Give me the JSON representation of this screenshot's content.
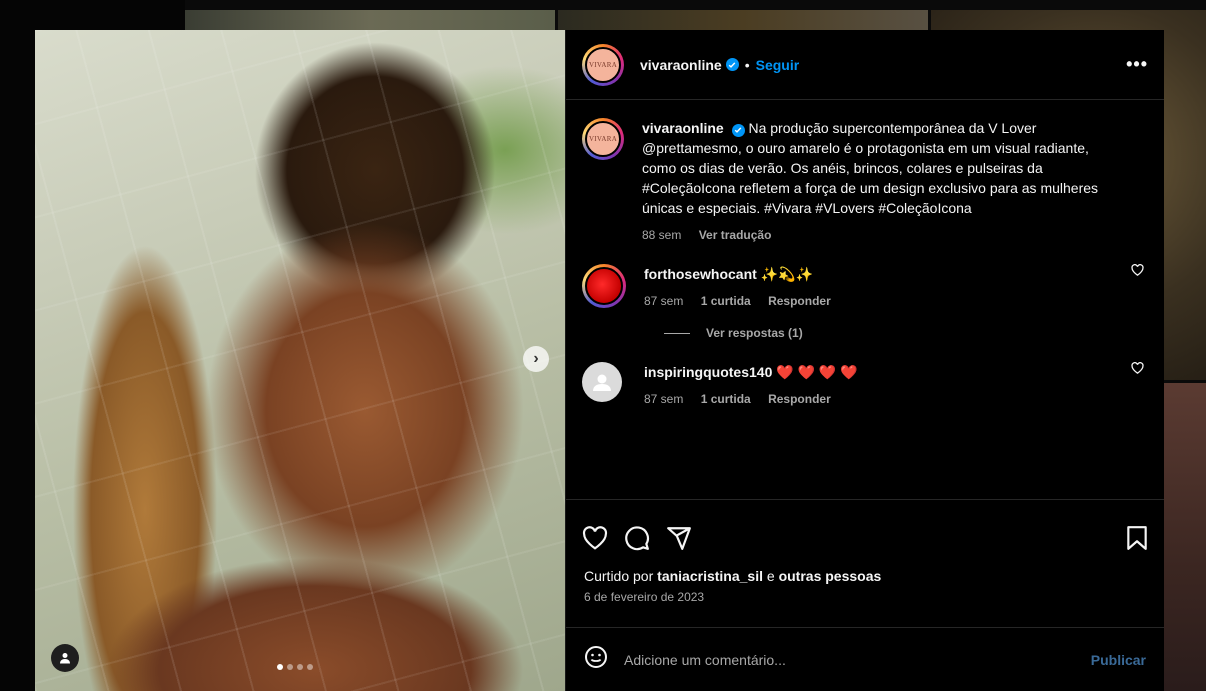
{
  "post": {
    "username": "vivaraonline",
    "avatar_text": "VIVARA",
    "follow_label": "Seguir",
    "separator": "•",
    "more_label": "•••",
    "carousel_next": "›",
    "carousel_dots": 4,
    "caption": {
      "username": "vivaraonline",
      "text": "Na produção supercontemporânea da V Lover @prettamesmo, o ouro amarelo é o protagonista em um visual radiante, como os dias de verão. Os anéis, brincos, colares e pulseiras da #ColeçãoIcona refletem a força de um design exclusivo para as mulheres únicas e especiais. #Vivara #VLovers #ColeçãoIcona",
      "time": "88 sem",
      "translate": "Ver tradução"
    },
    "comments": [
      {
        "username": "forthosewhocant",
        "text": "✨💫✨",
        "time": "87 sem",
        "likes": "1 curtida",
        "reply": "Responder",
        "view_replies": "Ver respostas (1)"
      },
      {
        "username": "inspiringquotes140",
        "text": "❤️ ❤️ ❤️ ❤️",
        "time": "87 sem",
        "likes": "1 curtida",
        "reply": "Responder"
      }
    ],
    "liked_by_prefix": "Curtido por",
    "liked_by_user": "taniacristina_sil",
    "liked_by_joiner": "e",
    "liked_by_suffix": "outras pessoas",
    "date": "6 de fevereiro de 2023",
    "add_comment_placeholder": "Adicione um comentário...",
    "publish_label": "Publicar"
  },
  "icons": [
    "like-icon",
    "comment-icon",
    "share-icon",
    "save-icon",
    "emoji-icon",
    "verified-icon",
    "user-tag-icon",
    "chevron-right-icon",
    "heart-small-icon"
  ],
  "colors": {
    "accent": "#0095f6",
    "background": "#000000",
    "muted": "#a8a8a8"
  }
}
